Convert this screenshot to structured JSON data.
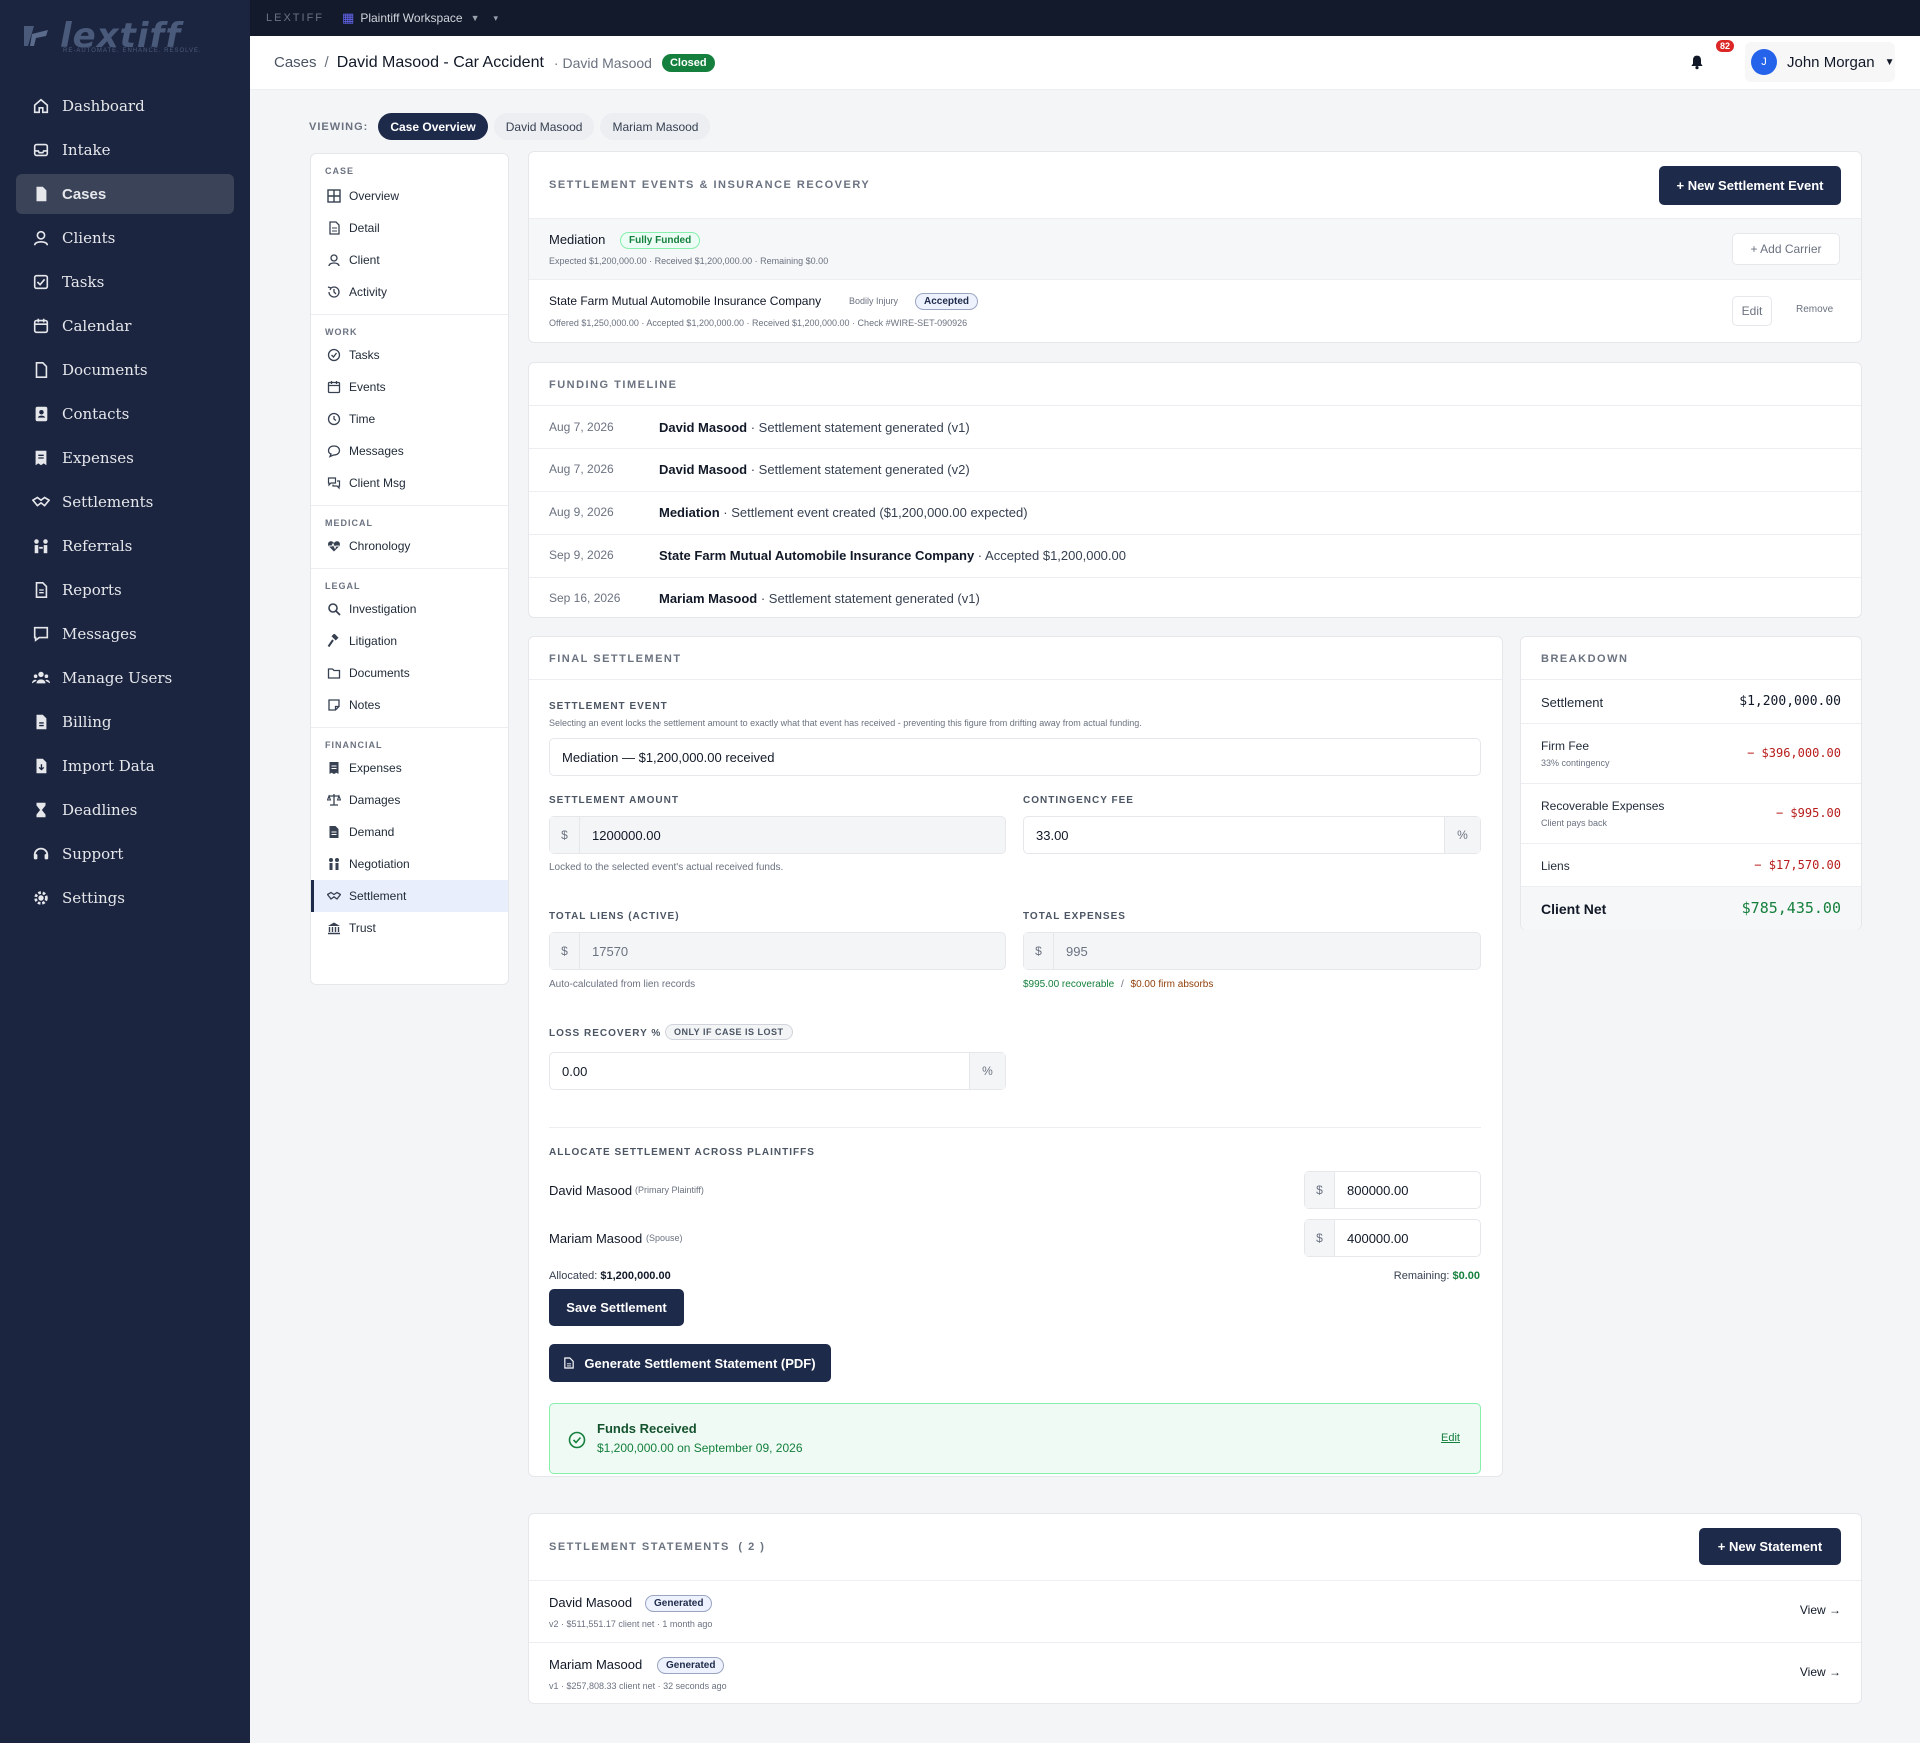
{
  "app": {
    "brand": "LEXTIFF",
    "logo_word": "lextiff",
    "logo_tagline": "RE-AUTOMATE. ENHANCE. RESOLVE.",
    "workspace": "Plaintiff Workspace"
  },
  "sidebar": {
    "items": [
      {
        "label": "Dashboard",
        "icon": "home-icon"
      },
      {
        "label": "Intake",
        "icon": "inbox-icon"
      },
      {
        "label": "Cases",
        "icon": "file-icon",
        "active": true
      },
      {
        "label": "Clients",
        "icon": "user-icon"
      },
      {
        "label": "Tasks",
        "icon": "checklist-icon"
      },
      {
        "label": "Calendar",
        "icon": "calendar-icon"
      },
      {
        "label": "Documents",
        "icon": "document-icon"
      },
      {
        "label": "Contacts",
        "icon": "contact-card-icon"
      },
      {
        "label": "Expenses",
        "icon": "receipt-icon"
      },
      {
        "label": "Settlements",
        "icon": "handshake-icon"
      },
      {
        "label": "Referrals",
        "icon": "people-arrows-icon"
      },
      {
        "label": "Reports",
        "icon": "report-icon"
      },
      {
        "label": "Messages",
        "icon": "message-icon"
      },
      {
        "label": "Manage Users",
        "icon": "users-icon"
      },
      {
        "label": "Billing",
        "icon": "billing-icon"
      },
      {
        "label": "Import Data",
        "icon": "import-icon"
      },
      {
        "label": "Deadlines",
        "icon": "hourglass-icon"
      },
      {
        "label": "Support",
        "icon": "headset-icon"
      },
      {
        "label": "Settings",
        "icon": "gear-icon"
      }
    ]
  },
  "header": {
    "crumb_root": "Cases",
    "crumb_sep": "/",
    "case_title": "David Masood - Car Accident",
    "case_client": "· David Masood",
    "status": "Closed",
    "notifications": "82",
    "user_initial": "J",
    "user_name": "John Morgan"
  },
  "viewing": {
    "label": "VIEWING:",
    "pills": [
      "Case Overview",
      "David Masood",
      "Mariam Masood"
    ]
  },
  "case_nav": {
    "sections": [
      {
        "title": "CASE",
        "items": [
          {
            "label": "Overview",
            "icon": "grid-icon"
          },
          {
            "label": "Detail",
            "icon": "document-icon"
          },
          {
            "label": "Client",
            "icon": "user-icon"
          },
          {
            "label": "Activity",
            "icon": "history-icon"
          }
        ]
      },
      {
        "title": "WORK",
        "items": [
          {
            "label": "Tasks",
            "icon": "check-circle-icon"
          },
          {
            "label": "Events",
            "icon": "calendar-icon"
          },
          {
            "label": "Time",
            "icon": "clock-icon"
          },
          {
            "label": "Messages",
            "icon": "chat-icon"
          },
          {
            "label": "Client Msg",
            "icon": "chat-double-icon"
          }
        ]
      },
      {
        "title": "MEDICAL",
        "items": [
          {
            "label": "Chronology",
            "icon": "heart-pulse-icon"
          }
        ]
      },
      {
        "title": "LEGAL",
        "items": [
          {
            "label": "Investigation",
            "icon": "search-icon"
          },
          {
            "label": "Litigation",
            "icon": "gavel-icon"
          },
          {
            "label": "Documents",
            "icon": "folder-icon"
          },
          {
            "label": "Notes",
            "icon": "note-icon"
          }
        ]
      },
      {
        "title": "FINANCIAL",
        "items": [
          {
            "label": "Expenses",
            "icon": "receipt-icon"
          },
          {
            "label": "Damages",
            "icon": "scale-icon"
          },
          {
            "label": "Demand",
            "icon": "file-invoice-icon"
          },
          {
            "label": "Negotiation",
            "icon": "negotiation-icon"
          },
          {
            "label": "Settlement",
            "icon": "handshake-icon",
            "active": true
          },
          {
            "label": "Trust",
            "icon": "bank-icon"
          }
        ]
      }
    ]
  },
  "settlement_events": {
    "title": "SETTLEMENT EVENTS & INSURANCE RECOVERY",
    "new_button": "+ New Settlement Event",
    "event": {
      "name": "Mediation",
      "status": "Fully Funded",
      "meta": "Expected $1,200,000.00 · Received $1,200,000.00 · Remaining $0.00",
      "add_carrier": "+ Add Carrier"
    },
    "carrier": {
      "name": "State Farm Mutual Automobile Insurance Company",
      "coverage": "Bodily Injury",
      "status": "Accepted",
      "meta": "Offered $1,250,000.00 · Accepted $1,200,000.00 · Received $1,200,000.00 · Check #WIRE-SET-090926",
      "edit": "Edit",
      "remove": "Remove"
    }
  },
  "timeline": {
    "title": "FUNDING TIMELINE",
    "rows": [
      {
        "date": "Aug 7, 2026",
        "who": "David Masood",
        "text": " · Settlement statement generated (v1)"
      },
      {
        "date": "Aug 7, 2026",
        "who": "David Masood",
        "text": " · Settlement statement generated (v2)"
      },
      {
        "date": "Aug 9, 2026",
        "who": "Mediation",
        "text": " · Settlement event created ($1,200,000.00 expected)"
      },
      {
        "date": "Sep 9, 2026",
        "who": "State Farm Mutual Automobile Insurance Company",
        "text": " · Accepted $1,200,000.00"
      },
      {
        "date": "Sep 16, 2026",
        "who": "Mariam Masood",
        "text": " · Settlement statement generated (v1)"
      }
    ]
  },
  "final": {
    "title": "FINAL SETTLEMENT",
    "event_label": "SETTLEMENT EVENT",
    "event_hint": "Selecting an event locks the settlement amount to exactly what that event has received - preventing this figure from drifting away from actual funding.",
    "event_value": "Mediation — $1,200,000.00 received",
    "amount_label": "SETTLEMENT AMOUNT",
    "amount_value": "1200000.00",
    "amount_hint": "Locked to the selected event's actual received funds.",
    "fee_label": "CONTINGENCY FEE",
    "fee_value": "33.00",
    "liens_label": "TOTAL LIENS (ACTIVE)",
    "liens_value": "17570",
    "liens_hint": "Auto-calculated from lien records",
    "expenses_label": "TOTAL EXPENSES",
    "expenses_value": "995",
    "expenses_recoverable": "$995.00 recoverable",
    "expenses_sep": "/",
    "expenses_absorbs": "$0.00 firm absorbs",
    "loss_label": "LOSS RECOVERY %",
    "loss_tag": "ONLY IF CASE IS LOST",
    "loss_value": "0.00",
    "dollar": "$",
    "percent": "%",
    "allocate_title": "ALLOCATE SETTLEMENT ACROSS PLAINTIFFS",
    "allocations": [
      {
        "name": "David Masood",
        "role": "(Primary Plaintiff)",
        "value": "800000.00"
      },
      {
        "name": "Mariam Masood",
        "role": "(Spouse)",
        "value": "400000.00"
      }
    ],
    "allocated_label": "Allocated:",
    "allocated_value": "$1,200,000.00",
    "remaining_label": "Remaining:",
    "remaining_value": "$0.00",
    "save_button": "Save Settlement",
    "pdf_button": "Generate Settlement Statement (PDF)",
    "funds_title": "Funds Received",
    "funds_text": "$1,200,000.00 on September 09, 2026",
    "funds_edit": "Edit"
  },
  "breakdown": {
    "title": "BREAKDOWN",
    "settlement_label": "Settlement",
    "settlement_value": "$1,200,000.00",
    "fee_label": "Firm Fee",
    "fee_sub": "33% contingency",
    "fee_value": "− $396,000.00",
    "expenses_label": "Recoverable Expenses",
    "expenses_sub": "Client pays back",
    "expenses_value": "− $995.00",
    "liens_label": "Liens",
    "liens_value": "− $17,570.00",
    "net_label": "Client Net",
    "net_value": "$785,435.00"
  },
  "statements": {
    "title": "SETTLEMENT STATEMENTS",
    "count": "( 2 )",
    "new_button": "+ New Statement",
    "rows": [
      {
        "name": "David Masood",
        "status": "Generated",
        "meta": "v2 · $511,551.17 client net · 1 month ago",
        "view": "View →"
      },
      {
        "name": "Mariam Masood",
        "status": "Generated",
        "meta": "v1 · $257,808.33 client net · 32 seconds ago",
        "view": "View →"
      }
    ]
  },
  "colors": {
    "sidebar_bg": "#1c2540",
    "primary": "#1e2a4a",
    "success": "#15803d",
    "danger": "#b91c1c"
  }
}
